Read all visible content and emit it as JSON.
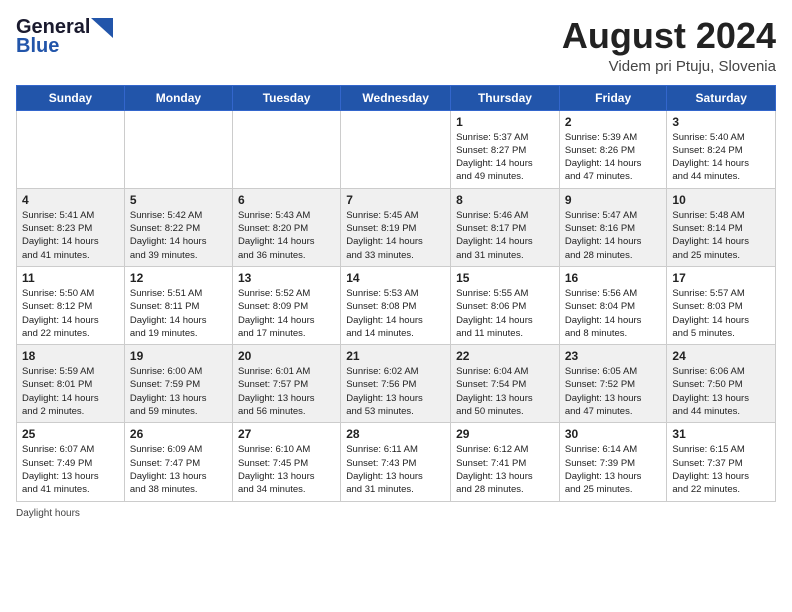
{
  "header": {
    "logo_line1": "General",
    "logo_line2": "Blue",
    "month_year": "August 2024",
    "location": "Videm pri Ptuju, Slovenia"
  },
  "days_of_week": [
    "Sunday",
    "Monday",
    "Tuesday",
    "Wednesday",
    "Thursday",
    "Friday",
    "Saturday"
  ],
  "weeks": [
    [
      {
        "day": "",
        "info": ""
      },
      {
        "day": "",
        "info": ""
      },
      {
        "day": "",
        "info": ""
      },
      {
        "day": "",
        "info": ""
      },
      {
        "day": "1",
        "info": "Sunrise: 5:37 AM\nSunset: 8:27 PM\nDaylight: 14 hours\nand 49 minutes."
      },
      {
        "day": "2",
        "info": "Sunrise: 5:39 AM\nSunset: 8:26 PM\nDaylight: 14 hours\nand 47 minutes."
      },
      {
        "day": "3",
        "info": "Sunrise: 5:40 AM\nSunset: 8:24 PM\nDaylight: 14 hours\nand 44 minutes."
      }
    ],
    [
      {
        "day": "4",
        "info": "Sunrise: 5:41 AM\nSunset: 8:23 PM\nDaylight: 14 hours\nand 41 minutes."
      },
      {
        "day": "5",
        "info": "Sunrise: 5:42 AM\nSunset: 8:22 PM\nDaylight: 14 hours\nand 39 minutes."
      },
      {
        "day": "6",
        "info": "Sunrise: 5:43 AM\nSunset: 8:20 PM\nDaylight: 14 hours\nand 36 minutes."
      },
      {
        "day": "7",
        "info": "Sunrise: 5:45 AM\nSunset: 8:19 PM\nDaylight: 14 hours\nand 33 minutes."
      },
      {
        "day": "8",
        "info": "Sunrise: 5:46 AM\nSunset: 8:17 PM\nDaylight: 14 hours\nand 31 minutes."
      },
      {
        "day": "9",
        "info": "Sunrise: 5:47 AM\nSunset: 8:16 PM\nDaylight: 14 hours\nand 28 minutes."
      },
      {
        "day": "10",
        "info": "Sunrise: 5:48 AM\nSunset: 8:14 PM\nDaylight: 14 hours\nand 25 minutes."
      }
    ],
    [
      {
        "day": "11",
        "info": "Sunrise: 5:50 AM\nSunset: 8:12 PM\nDaylight: 14 hours\nand 22 minutes."
      },
      {
        "day": "12",
        "info": "Sunrise: 5:51 AM\nSunset: 8:11 PM\nDaylight: 14 hours\nand 19 minutes."
      },
      {
        "day": "13",
        "info": "Sunrise: 5:52 AM\nSunset: 8:09 PM\nDaylight: 14 hours\nand 17 minutes."
      },
      {
        "day": "14",
        "info": "Sunrise: 5:53 AM\nSunset: 8:08 PM\nDaylight: 14 hours\nand 14 minutes."
      },
      {
        "day": "15",
        "info": "Sunrise: 5:55 AM\nSunset: 8:06 PM\nDaylight: 14 hours\nand 11 minutes."
      },
      {
        "day": "16",
        "info": "Sunrise: 5:56 AM\nSunset: 8:04 PM\nDaylight: 14 hours\nand 8 minutes."
      },
      {
        "day": "17",
        "info": "Sunrise: 5:57 AM\nSunset: 8:03 PM\nDaylight: 14 hours\nand 5 minutes."
      }
    ],
    [
      {
        "day": "18",
        "info": "Sunrise: 5:59 AM\nSunset: 8:01 PM\nDaylight: 14 hours\nand 2 minutes."
      },
      {
        "day": "19",
        "info": "Sunrise: 6:00 AM\nSunset: 7:59 PM\nDaylight: 13 hours\nand 59 minutes."
      },
      {
        "day": "20",
        "info": "Sunrise: 6:01 AM\nSunset: 7:57 PM\nDaylight: 13 hours\nand 56 minutes."
      },
      {
        "day": "21",
        "info": "Sunrise: 6:02 AM\nSunset: 7:56 PM\nDaylight: 13 hours\nand 53 minutes."
      },
      {
        "day": "22",
        "info": "Sunrise: 6:04 AM\nSunset: 7:54 PM\nDaylight: 13 hours\nand 50 minutes."
      },
      {
        "day": "23",
        "info": "Sunrise: 6:05 AM\nSunset: 7:52 PM\nDaylight: 13 hours\nand 47 minutes."
      },
      {
        "day": "24",
        "info": "Sunrise: 6:06 AM\nSunset: 7:50 PM\nDaylight: 13 hours\nand 44 minutes."
      }
    ],
    [
      {
        "day": "25",
        "info": "Sunrise: 6:07 AM\nSunset: 7:49 PM\nDaylight: 13 hours\nand 41 minutes."
      },
      {
        "day": "26",
        "info": "Sunrise: 6:09 AM\nSunset: 7:47 PM\nDaylight: 13 hours\nand 38 minutes."
      },
      {
        "day": "27",
        "info": "Sunrise: 6:10 AM\nSunset: 7:45 PM\nDaylight: 13 hours\nand 34 minutes."
      },
      {
        "day": "28",
        "info": "Sunrise: 6:11 AM\nSunset: 7:43 PM\nDaylight: 13 hours\nand 31 minutes."
      },
      {
        "day": "29",
        "info": "Sunrise: 6:12 AM\nSunset: 7:41 PM\nDaylight: 13 hours\nand 28 minutes."
      },
      {
        "day": "30",
        "info": "Sunrise: 6:14 AM\nSunset: 7:39 PM\nDaylight: 13 hours\nand 25 minutes."
      },
      {
        "day": "31",
        "info": "Sunrise: 6:15 AM\nSunset: 7:37 PM\nDaylight: 13 hours\nand 22 minutes."
      }
    ]
  ],
  "footer": {
    "daylight_label": "Daylight hours"
  }
}
